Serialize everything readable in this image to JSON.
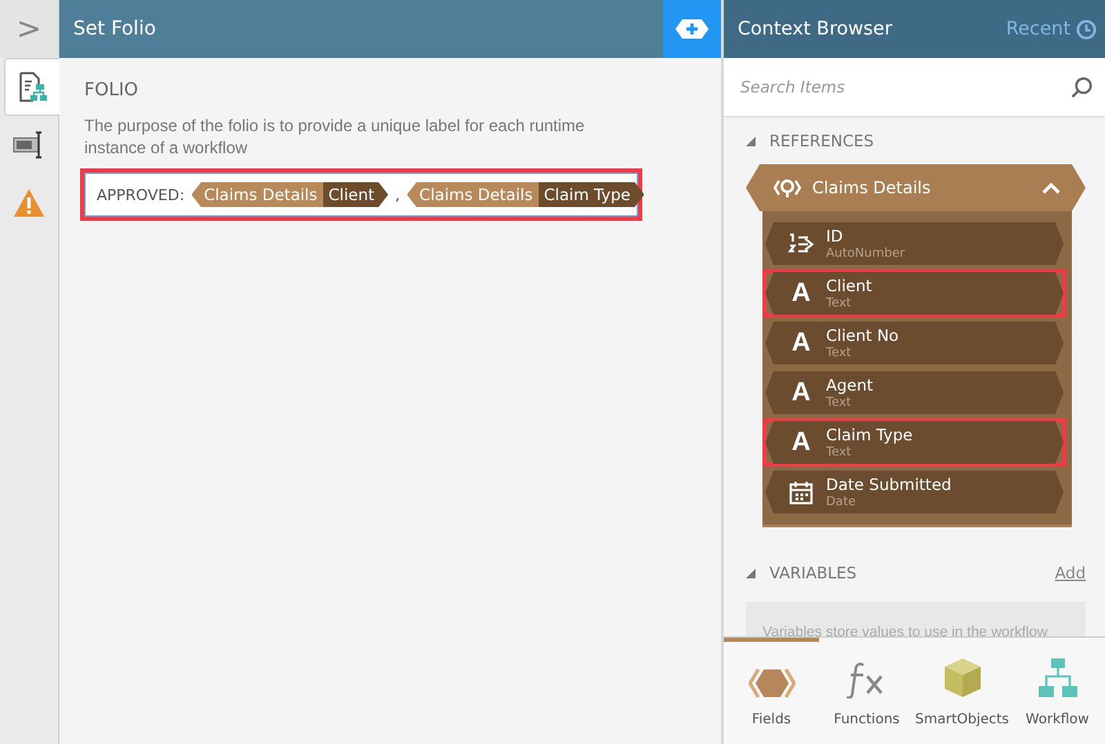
{
  "rail": {
    "toggle": ">",
    "tabs": [
      {
        "kind": "folio",
        "selected": true
      },
      {
        "kind": "properties",
        "selected": false
      },
      {
        "kind": "warning",
        "selected": false
      }
    ]
  },
  "header": {
    "title": "Set Folio"
  },
  "folio": {
    "heading": "FOLIO",
    "description": "The purpose of the folio is to provide a unique label for each runtime instance of a workflow",
    "highlighted": true,
    "tokens": [
      {
        "kind": "text",
        "text": "APPROVED:"
      },
      {
        "kind": "field",
        "source": "Claims Details",
        "field": "Client"
      },
      {
        "kind": "text",
        "text": ","
      },
      {
        "kind": "field",
        "source": "Claims Details",
        "field": "Claim Type"
      }
    ]
  },
  "context": {
    "title": "Context Browser",
    "recent": "Recent",
    "search": {
      "placeholder": "Search Items"
    },
    "references": {
      "title": "REFERENCES",
      "expanded": true,
      "group": {
        "name": "Claims Details",
        "expanded": true,
        "items": [
          {
            "name": "ID",
            "type": "AutoNumber",
            "kind": "number",
            "highlighted": false
          },
          {
            "name": "Client",
            "type": "Text",
            "kind": "text",
            "glyph": "A",
            "highlighted": true
          },
          {
            "name": "Client No",
            "type": "Text",
            "kind": "text",
            "glyph": "A",
            "highlighted": false
          },
          {
            "name": "Agent",
            "type": "Text",
            "kind": "text",
            "glyph": "A",
            "highlighted": false
          },
          {
            "name": "Claim Type",
            "type": "Text",
            "kind": "text",
            "glyph": "A",
            "highlighted": true
          },
          {
            "name": "Date Submitted",
            "type": "Date",
            "kind": "date",
            "highlighted": false
          }
        ]
      }
    },
    "variables": {
      "title": "VARIABLES",
      "expanded": true,
      "add": "Add",
      "hint": "Variables store values to use in the workflow"
    },
    "footer_tabs": [
      {
        "label": "Fields",
        "kind": "fields",
        "selected": true
      },
      {
        "label": "Functions",
        "kind": "functions",
        "selected": false
      },
      {
        "label": "SmartObjects",
        "kind": "smartobjects",
        "selected": false
      },
      {
        "label": "Workflow",
        "kind": "workflow",
        "selected": false
      }
    ]
  }
}
